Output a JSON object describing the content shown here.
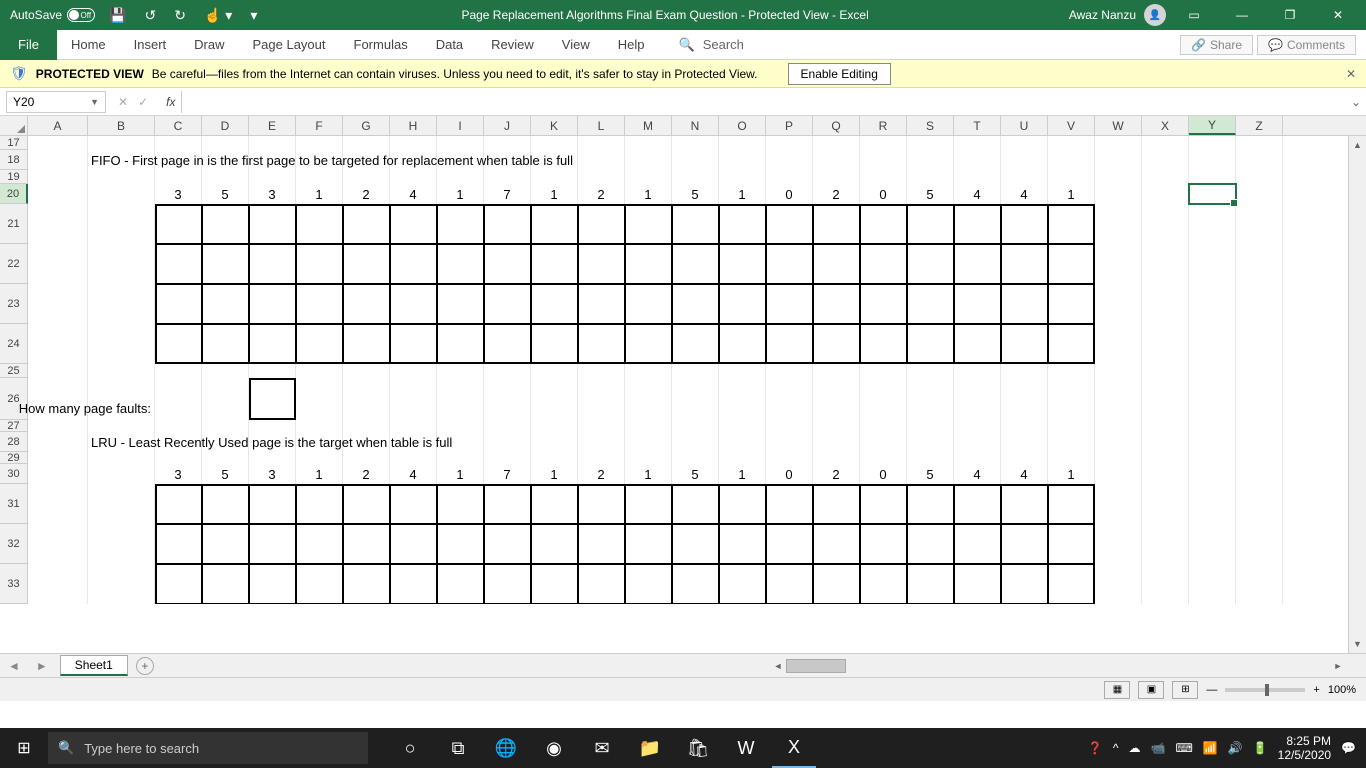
{
  "titlebar": {
    "autosave_label": "AutoSave",
    "autosave_state": "Off",
    "doc_title": "Page Replacement Algorithms Final Exam Question  -  Protected View  -  Excel",
    "username": "Awaz Nanzu"
  },
  "ribbon": {
    "tabs": [
      "File",
      "Home",
      "Insert",
      "Draw",
      "Page Layout",
      "Formulas",
      "Data",
      "Review",
      "View",
      "Help"
    ],
    "search_placeholder": "Search",
    "share": "Share",
    "comments": "Comments"
  },
  "protected": {
    "label": "PROTECTED VIEW",
    "message": "Be careful—files from the Internet can contain viruses. Unless you need to edit, it's safer to stay in Protected View.",
    "button": "Enable Editing"
  },
  "namebox": {
    "value": "Y20"
  },
  "columns": [
    "A",
    "B",
    "C",
    "D",
    "E",
    "F",
    "G",
    "H",
    "I",
    "J",
    "K",
    "L",
    "M",
    "N",
    "O",
    "P",
    "Q",
    "R",
    "S",
    "T",
    "U",
    "V",
    "W",
    "X",
    "Y",
    "Z"
  ],
  "col_widths": {
    "default": 47,
    "A": 60,
    "B": 67
  },
  "rows_visible": [
    "17",
    "18",
    "19",
    "20",
    "21",
    "22",
    "23",
    "24",
    "25",
    "26",
    "27",
    "28",
    "29",
    "30",
    "31",
    "32",
    "33"
  ],
  "row_heights": {
    "default": 20,
    "20": 20,
    "21": 40,
    "22": 40,
    "23": 40,
    "24": 40,
    "26": 42,
    "31": 40,
    "32": 40,
    "33": 40,
    "17": 14,
    "19": 14,
    "25": 14,
    "27": 12,
    "29": 12
  },
  "content": {
    "fifo_text": "FIFO - First page in is the first page to be targeted for replacement when table is full",
    "lru_text": "LRU - Least Recently Used page is the target when table is full",
    "faults_label": "How many page faults:",
    "sequence": [
      "3",
      "5",
      "3",
      "1",
      "2",
      "4",
      "1",
      "7",
      "1",
      "2",
      "1",
      "5",
      "1",
      "0",
      "2",
      "0",
      "5",
      "4",
      "4",
      "1"
    ]
  },
  "selected_cell": {
    "col": "Y",
    "row": "20"
  },
  "sheet": {
    "active": "Sheet1"
  },
  "statusbar": {
    "zoom": "100%"
  },
  "taskbar": {
    "search_placeholder": "Type here to search",
    "time": "8:25 PM",
    "date": "12/5/2020"
  }
}
